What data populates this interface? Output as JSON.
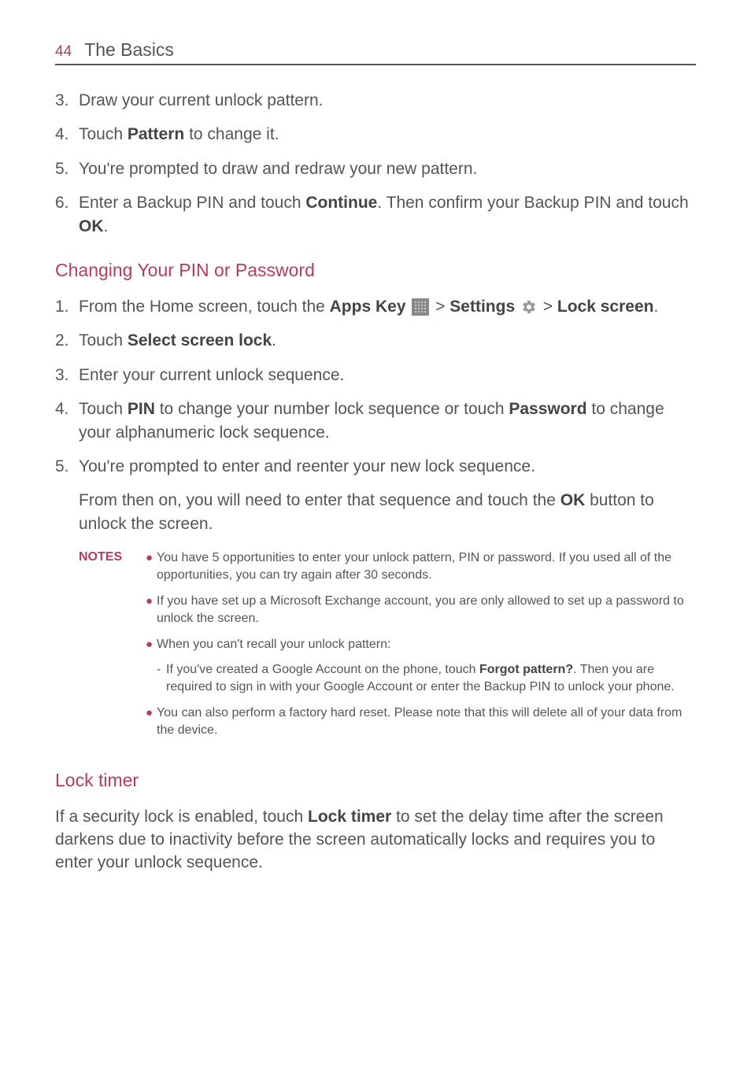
{
  "header": {
    "page_number": "44",
    "section": "The Basics"
  },
  "list1": {
    "i3_num": "3.",
    "i3": "Draw your current unlock pattern.",
    "i4_num": "4.",
    "i4_a": "Touch ",
    "i4_b": "Pattern",
    "i4_c": " to change it.",
    "i5_num": "5.",
    "i5": "You're prompted to draw and redraw your new pattern.",
    "i6_num": "6.",
    "i6_a": "Enter a Backup PIN and touch ",
    "i6_b": "Continue",
    "i6_c": ". Then confirm your Backup PIN and touch ",
    "i6_d": "OK",
    "i6_e": "."
  },
  "subheading1": "Changing Your PIN or Password",
  "list2": {
    "i1_num": "1.",
    "i1_a": "From the Home screen, touch the ",
    "i1_b": "Apps Key",
    "i1_c": " > ",
    "i1_d": "Settings",
    "i1_e": " > ",
    "i1_f": "Lock screen",
    "i1_g": ".",
    "i2_num": "2.",
    "i2_a": "Touch ",
    "i2_b": "Select screen lock",
    "i2_c": ".",
    "i3_num": "3.",
    "i3": "Enter your current unlock sequence.",
    "i4_num": "4.",
    "i4_a": "Touch ",
    "i4_b": "PIN",
    "i4_c": " to change your number lock sequence or touch ",
    "i4_d": "Password",
    "i4_e": " to change your alphanumeric lock sequence.",
    "i5_num": "5.",
    "i5": "You're prompted to enter and reenter your new lock sequence."
  },
  "para_cont_a": "From then on, you will need to enter that sequence and touch the ",
  "para_cont_b": "OK",
  "para_cont_c": " button to unlock the screen.",
  "notes": {
    "label": "NOTES",
    "n1": "You have 5 opportunities to enter your unlock pattern, PIN or password. If you used all of the opportunities, you can try again after 30 seconds.",
    "n2": "If you have set up a Microsoft Exchange account, you are only allowed to set up a password to unlock the screen.",
    "n3": "When you can't recall your unlock pattern:",
    "n3s_a": "If you've created a Google Account on the phone, touch ",
    "n3s_b": "Forgot pattern?",
    "n3s_c": ". Then you are required to sign in with your Google Account or enter the Backup PIN to unlock your phone.",
    "n4": "You can also perform a factory hard reset. Please note that this will delete all of your data from the device."
  },
  "subheading2": "Lock timer",
  "locktimer": {
    "a": "If a security lock is enabled, touch ",
    "b": "Lock timer",
    "c": " to set the delay time after the screen darkens due to inactivity before the screen automatically locks and requires you to enter your unlock sequence."
  }
}
